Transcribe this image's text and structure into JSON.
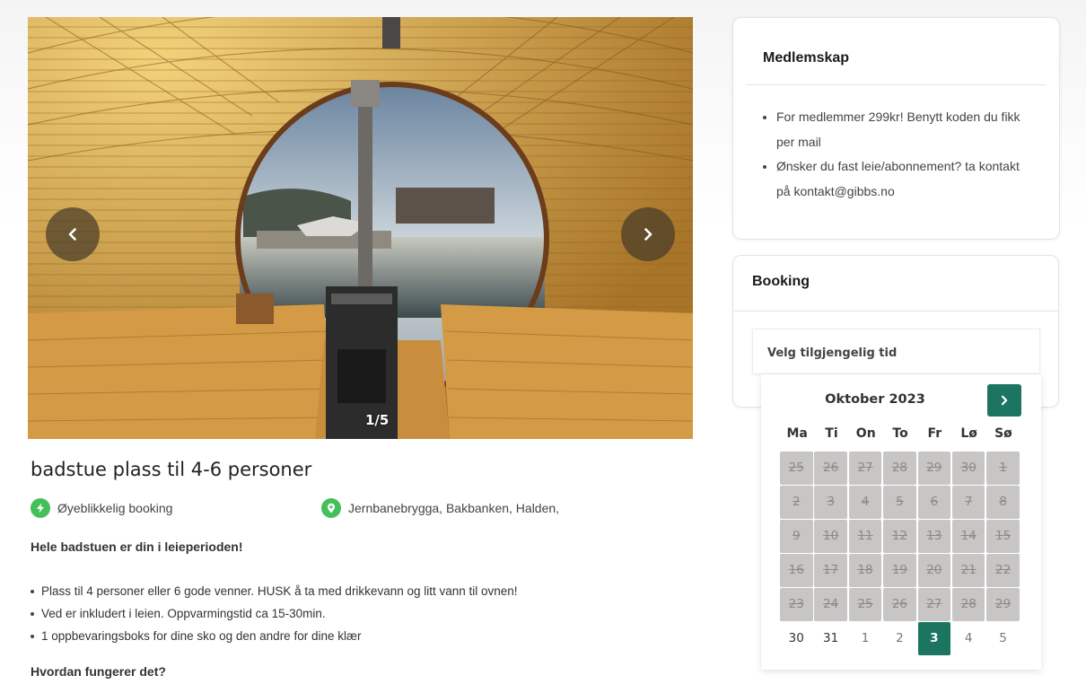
{
  "gallery": {
    "counter": "1/5",
    "prev_icon": "chevron-left-icon",
    "next_icon": "chevron-right-icon"
  },
  "listing": {
    "title": "badstue plass til 4-6 personer",
    "instant_booking": "Øyeblikkelig booking",
    "location": "Jernbanebrygga, Bakbanken, Halden,",
    "heading": "Hele badstuen er din i leieperioden!",
    "features": [
      "Plass til 4 personer eller 6 gode venner. HUSK å ta med drikkevann og litt vann til ovnen!",
      "Ved er inkludert i leien. Oppvarmingstid ca 15-30min.",
      "1 oppbevaringsboks for dine sko og den andre for dine klær"
    ],
    "how_heading": "Hvordan fungerer det?"
  },
  "membership": {
    "title": "Medlemskap",
    "items": [
      "For medlemmer 299kr! Benytt koden du fikk per mail",
      "Ønsker du fast leie/abonnement? ta kontakt på kontakt@gibbs.no"
    ]
  },
  "booking": {
    "title": "Booking",
    "select_label": "Velg tilgjengelig tid"
  },
  "calendar": {
    "month": "Oktober 2023",
    "weekdays": [
      "Ma",
      "Ti",
      "On",
      "To",
      "Fr",
      "Lø",
      "Sø"
    ],
    "days": [
      {
        "d": "25",
        "s": "past"
      },
      {
        "d": "26",
        "s": "past"
      },
      {
        "d": "27",
        "s": "past"
      },
      {
        "d": "28",
        "s": "past"
      },
      {
        "d": "29",
        "s": "past"
      },
      {
        "d": "30",
        "s": "past"
      },
      {
        "d": "1",
        "s": "past"
      },
      {
        "d": "2",
        "s": "past"
      },
      {
        "d": "3",
        "s": "past"
      },
      {
        "d": "4",
        "s": "past"
      },
      {
        "d": "5",
        "s": "past"
      },
      {
        "d": "6",
        "s": "past"
      },
      {
        "d": "7",
        "s": "past"
      },
      {
        "d": "8",
        "s": "past"
      },
      {
        "d": "9",
        "s": "past"
      },
      {
        "d": "10",
        "s": "past"
      },
      {
        "d": "11",
        "s": "past"
      },
      {
        "d": "12",
        "s": "past"
      },
      {
        "d": "13",
        "s": "past"
      },
      {
        "d": "14",
        "s": "past"
      },
      {
        "d": "15",
        "s": "past"
      },
      {
        "d": "16",
        "s": "past"
      },
      {
        "d": "17",
        "s": "past"
      },
      {
        "d": "18",
        "s": "past"
      },
      {
        "d": "19",
        "s": "past"
      },
      {
        "d": "20",
        "s": "past"
      },
      {
        "d": "21",
        "s": "past"
      },
      {
        "d": "22",
        "s": "past"
      },
      {
        "d": "23",
        "s": "past"
      },
      {
        "d": "24",
        "s": "past"
      },
      {
        "d": "25",
        "s": "past"
      },
      {
        "d": "26",
        "s": "past"
      },
      {
        "d": "27",
        "s": "past"
      },
      {
        "d": "28",
        "s": "past"
      },
      {
        "d": "29",
        "s": "past"
      },
      {
        "d": "30",
        "s": "cur"
      },
      {
        "d": "31",
        "s": "cur"
      },
      {
        "d": "1",
        "s": "nxt"
      },
      {
        "d": "2",
        "s": "nxt"
      },
      {
        "d": "3",
        "s": "sel"
      },
      {
        "d": "4",
        "s": "nxt"
      },
      {
        "d": "5",
        "s": "nxt"
      }
    ],
    "accent": "#1b7561"
  },
  "colors": {
    "accent": "#1b7561",
    "instant_icon_bg": "#43c05a",
    "disabled_day_bg": "#c8c5c5"
  }
}
